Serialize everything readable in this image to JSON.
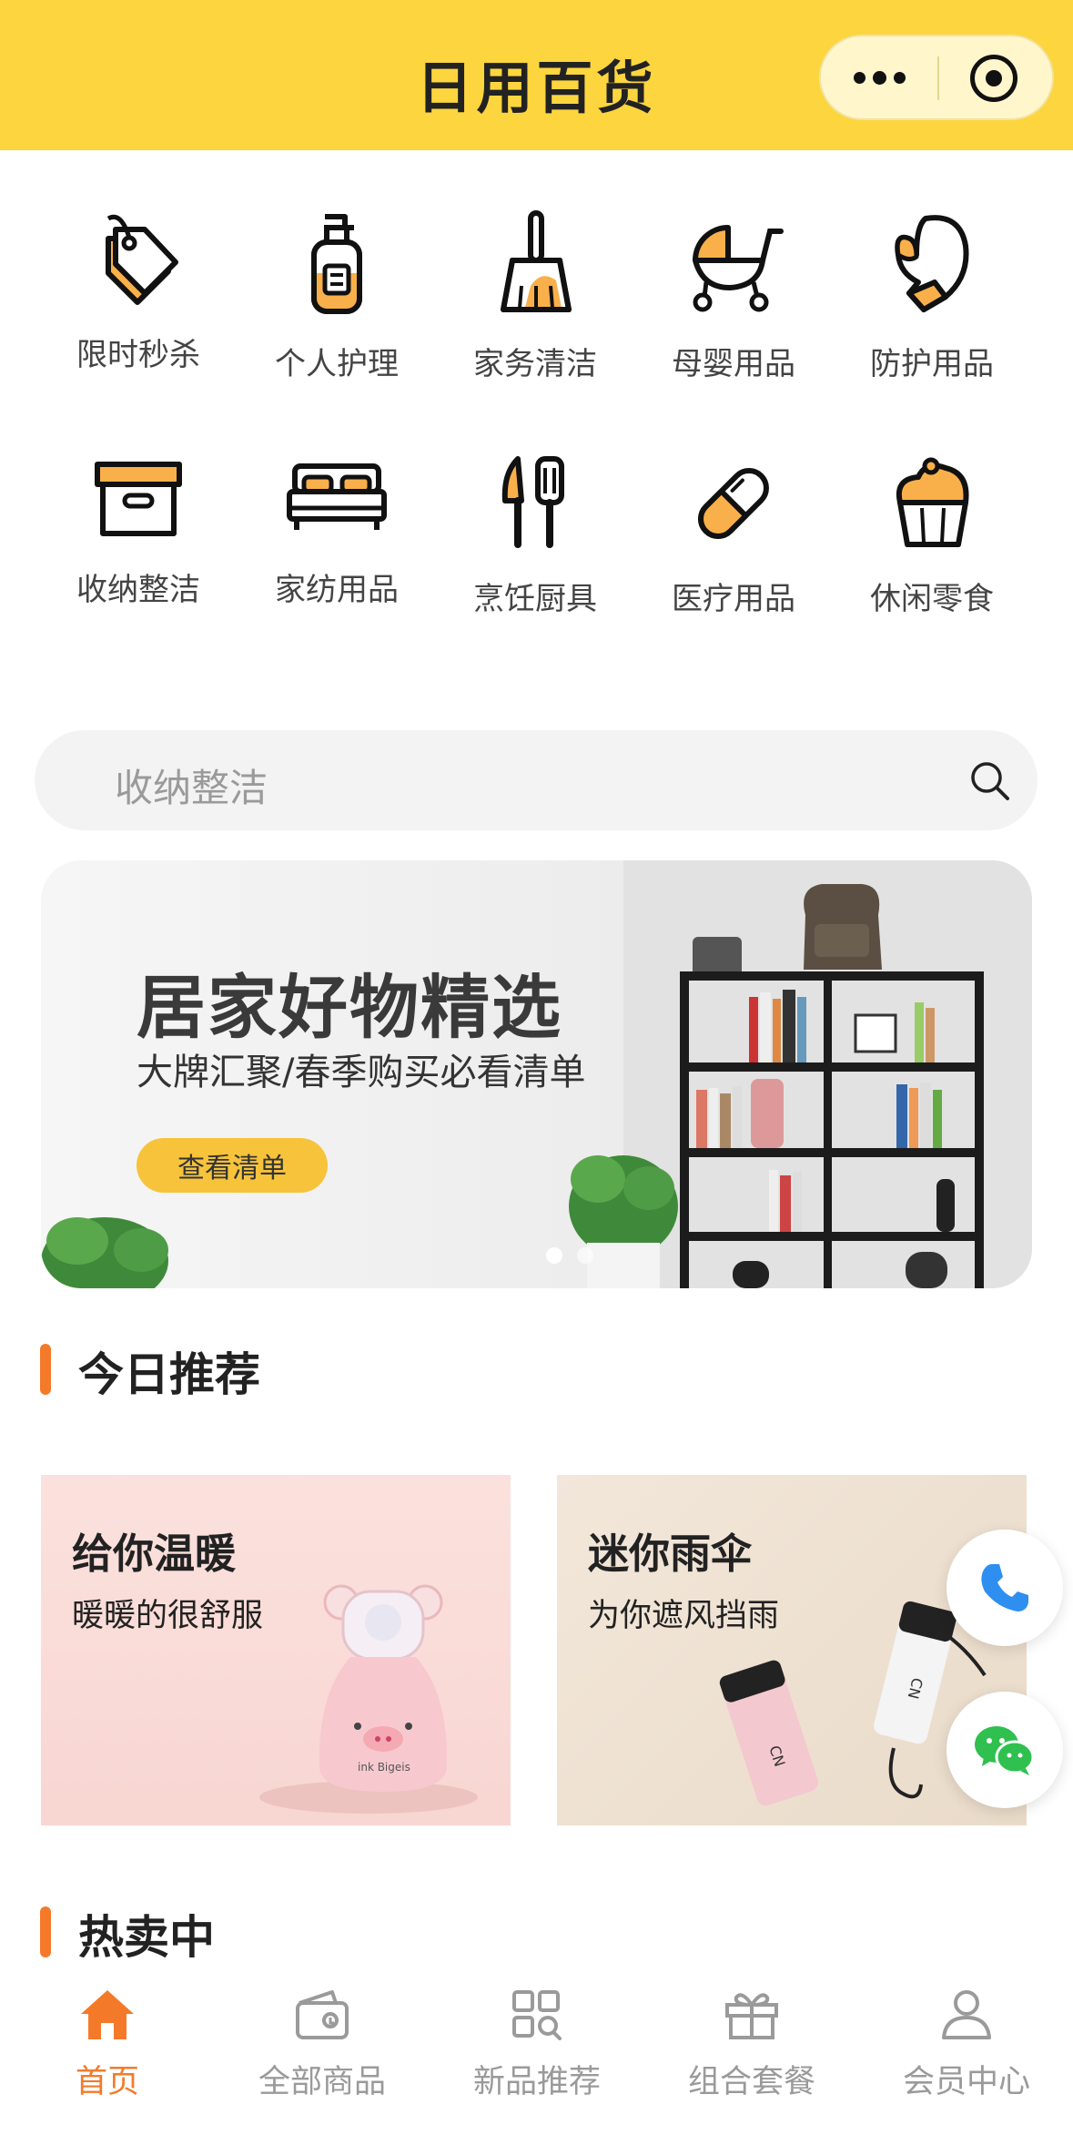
{
  "header": {
    "title": "日用百货",
    "menu_icon": "more-dots-icon",
    "close_icon": "target-icon"
  },
  "categories": [
    {
      "label": "限时秒杀",
      "icon": "price-tag-icon"
    },
    {
      "label": "个人护理",
      "icon": "lotion-bottle-icon"
    },
    {
      "label": "家务清洁",
      "icon": "broom-icon"
    },
    {
      "label": "母婴用品",
      "icon": "stroller-icon"
    },
    {
      "label": "防护用品",
      "icon": "glove-icon"
    },
    {
      "label": "收纳整洁",
      "icon": "storage-box-icon"
    },
    {
      "label": "家纺用品",
      "icon": "bed-icon"
    },
    {
      "label": "烹饪厨具",
      "icon": "kitchen-utensils-icon"
    },
    {
      "label": "医疗用品",
      "icon": "pill-icon"
    },
    {
      "label": "休闲零食",
      "icon": "cupcake-icon"
    }
  ],
  "search": {
    "placeholder": "收纳整洁"
  },
  "banner": {
    "title": "居家好物精选",
    "subtitle": "大牌汇聚/春季购买必看清单",
    "button": "查看清单",
    "slides": 2,
    "active_slide": 1
  },
  "recommend": {
    "title": "今日推荐",
    "cards": [
      {
        "title": "给你温暖",
        "subtitle": "暖暖的很舒服",
        "bottle_text": "ink Bigeis"
      },
      {
        "title": "迷你雨伞",
        "subtitle": "为你遮风挡雨",
        "umbrella_text": "CN"
      }
    ]
  },
  "hot": {
    "title": "热卖中"
  },
  "tabs": [
    {
      "label": "首页",
      "icon": "home-icon",
      "active": true
    },
    {
      "label": "全部商品",
      "icon": "wallet-icon",
      "active": false
    },
    {
      "label": "新品推荐",
      "icon": "grid-search-icon",
      "active": false
    },
    {
      "label": "组合套餐",
      "icon": "gift-icon",
      "active": false
    },
    {
      "label": "会员中心",
      "icon": "user-icon",
      "active": false
    }
  ],
  "colors": {
    "brand_yellow": "#fdd53e",
    "accent_orange": "#f47a2a",
    "icon_orange": "#f9b04a",
    "phone_blue": "#2e8ff0",
    "wechat_green": "#2fc04f"
  }
}
